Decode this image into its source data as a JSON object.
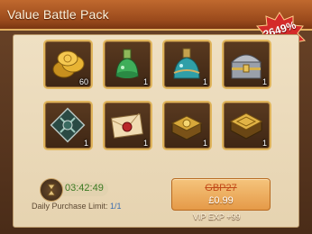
{
  "header": {
    "title": "Value Battle Pack"
  },
  "badge": {
    "label": "2649%"
  },
  "items": [
    {
      "name": "gold-coins",
      "count": "60"
    },
    {
      "name": "green-potion",
      "count": "1"
    },
    {
      "name": "teal-potion",
      "count": "1"
    },
    {
      "name": "silver-treasure-chest",
      "count": "1"
    },
    {
      "name": "shield-emblem",
      "count": "1"
    },
    {
      "name": "sealed-letter",
      "count": "1"
    },
    {
      "name": "golden-book",
      "count": "1"
    },
    {
      "name": "golden-tome",
      "count": "1"
    }
  ],
  "timer": {
    "value": "03:42:49"
  },
  "limit": {
    "label": "Daily Purchase Limit: ",
    "value": "1/1"
  },
  "purchase": {
    "old_price": "GBP27",
    "price": "£0.99",
    "vip": "VIP EXP +99"
  },
  "colors": {
    "accent": "#e0b55c",
    "timer": "#3c7a22",
    "badge": "#d42a2a"
  }
}
